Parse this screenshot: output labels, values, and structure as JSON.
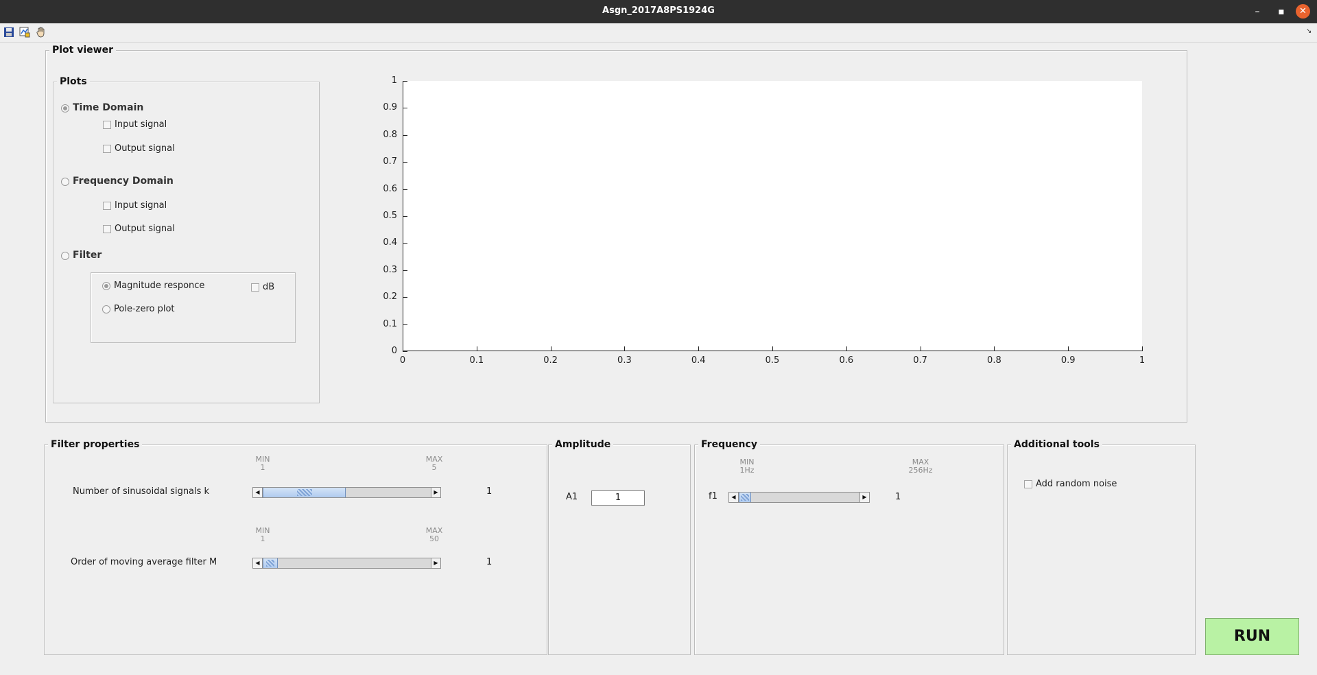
{
  "window": {
    "title": "Asgn_2017A8PS1924G",
    "min_glyph": "–",
    "max_glyph": "▪",
    "close_glyph": "✕"
  },
  "toolbar": {
    "icons": [
      "save-icon",
      "data-cursor-icon",
      "pan-hand-icon"
    ],
    "dock_glyph": "↘"
  },
  "plot_viewer": {
    "title": "Plot viewer",
    "plots_panel": {
      "title": "Plots",
      "time_domain": {
        "label": "Time Domain",
        "selected": true,
        "input_label": "Input signal",
        "output_label": "Output signal"
      },
      "frequency_domain": {
        "label": "Frequency Domain",
        "selected": false,
        "input_label": "Input signal",
        "output_label": "Output signal"
      },
      "filter": {
        "label": "Filter",
        "selected": false,
        "magnitude_label": "Magnitude responce",
        "magnitude_selected": true,
        "polezero_label": "Pole-zero plot",
        "db_label": "dB"
      }
    }
  },
  "chart_data": {
    "type": "line",
    "title": "",
    "xlabel": "",
    "ylabel": "",
    "xlim": [
      0,
      1
    ],
    "ylim": [
      0,
      1
    ],
    "xticks": [
      "0",
      "0.1",
      "0.2",
      "0.3",
      "0.4",
      "0.5",
      "0.6",
      "0.7",
      "0.8",
      "0.9",
      "1"
    ],
    "yticks": [
      "0",
      "0.1",
      "0.2",
      "0.3",
      "0.4",
      "0.5",
      "0.6",
      "0.7",
      "0.8",
      "0.9",
      "1"
    ],
    "series": [],
    "grid": false
  },
  "filter_properties": {
    "title": "Filter properties",
    "k_slider": {
      "label": "Number of sinusoidal signals k",
      "min_label": "MIN",
      "min_value": "1",
      "max_label": "MAX",
      "max_value": "5",
      "value": "1",
      "position": 0.5
    },
    "m_slider": {
      "label": "Order of moving average filter M",
      "min_label": "MIN",
      "min_value": "1",
      "max_label": "MAX",
      "max_value": "50",
      "value": "1",
      "position": 0.0
    }
  },
  "amplitude": {
    "title": "Amplitude",
    "a1_label": "A1",
    "a1_value": "1"
  },
  "frequency": {
    "title": "Frequency",
    "f1_label": "f1",
    "min_label": "MIN",
    "min_value": "1Hz",
    "max_label": "MAX",
    "max_value": "256Hz",
    "value": "1",
    "position": 0.0
  },
  "additional_tools": {
    "title": "Additional tools",
    "noise_label": "Add random noise"
  },
  "run_label": "RUN"
}
